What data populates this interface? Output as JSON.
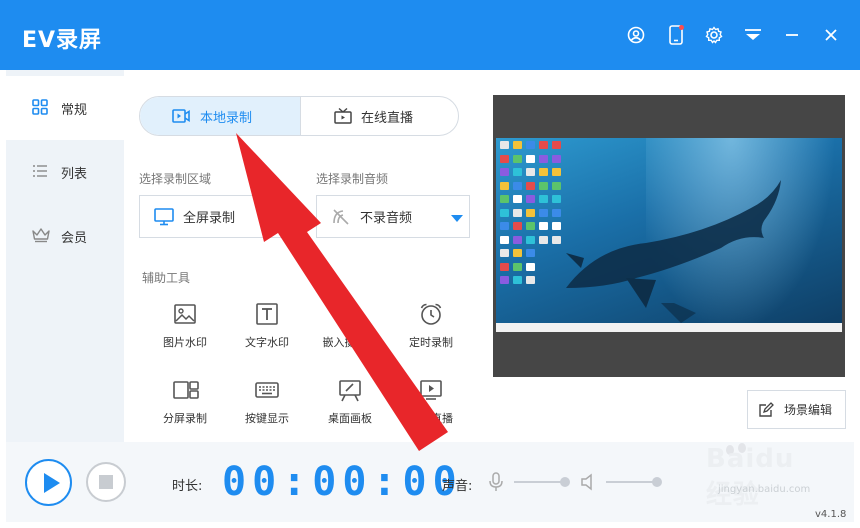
{
  "app": {
    "title": "EV录屏",
    "version": "v4.1.8"
  },
  "titlebar": {
    "icons": [
      "user-icon",
      "phone-icon",
      "gear-icon",
      "menu-icon",
      "minimize-icon",
      "close-icon"
    ]
  },
  "sidebar": {
    "items": [
      {
        "label": "常规",
        "icon": "grid-icon",
        "active": true
      },
      {
        "label": "列表",
        "icon": "list-icon",
        "active": false
      },
      {
        "label": "会员",
        "icon": "crown-icon",
        "active": false
      }
    ]
  },
  "tabs": [
    {
      "label": "本地录制",
      "icon": "video-camera-icon",
      "active": true
    },
    {
      "label": "在线直播",
      "icon": "tv-icon",
      "active": false
    }
  ],
  "record_area": {
    "label": "选择录制区域",
    "value": "全屏录制"
  },
  "record_audio": {
    "label": "选择录制音频",
    "value": "不录音频"
  },
  "tools": {
    "label": "辅助工具",
    "items": [
      {
        "label": "图片水印",
        "icon": "image-icon"
      },
      {
        "label": "文字水印",
        "icon": "text-icon"
      },
      {
        "label": "嵌入摄像头",
        "icon": "webcam-icon"
      },
      {
        "label": "定时录制",
        "icon": "alarm-icon"
      },
      {
        "label": "分屏录制",
        "icon": "split-screen-icon"
      },
      {
        "label": "按键显示",
        "icon": "keyboard-icon"
      },
      {
        "label": "桌面画板",
        "icon": "easel-icon"
      },
      {
        "label": "本地直播",
        "icon": "local-live-icon"
      }
    ]
  },
  "scene_edit": {
    "label": "场景编辑"
  },
  "bottom": {
    "duration_label": "时长:",
    "timer": "00:00:00",
    "sound_label": "声音:"
  },
  "watermark": {
    "brand": "Baidu经验",
    "url": "jingyan.baidu.com"
  },
  "colors": {
    "primary": "#1e8cf0",
    "annotation_arrow": "#e8262a"
  }
}
